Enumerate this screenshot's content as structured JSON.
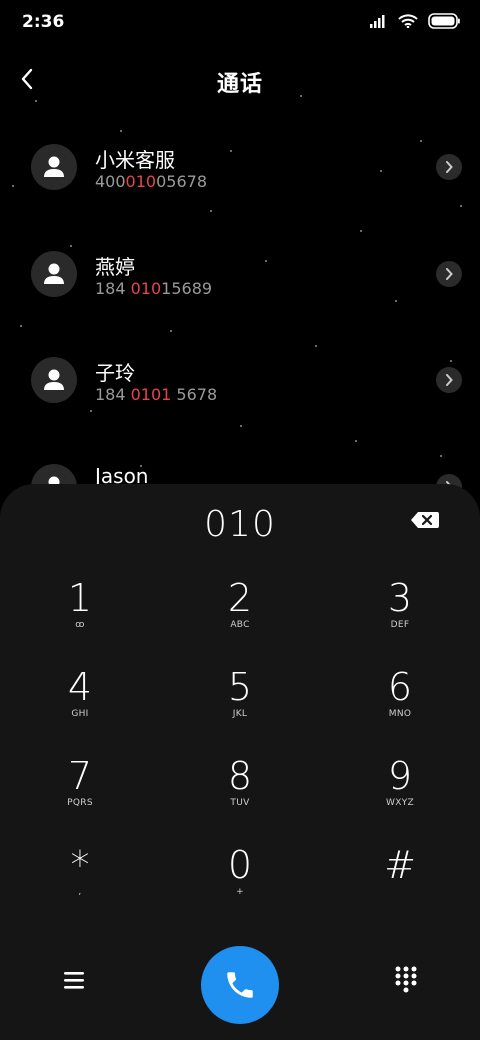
{
  "status": {
    "time": "2:36"
  },
  "header": {
    "title": "通话"
  },
  "contacts": [
    {
      "name": "小米客服",
      "num_pre": "400",
      "num_hl": "010",
      "num_post": "05678"
    },
    {
      "name": "燕婷",
      "num_pre": "184 ",
      "num_hl": "010",
      "num_post": "15689"
    },
    {
      "name": "子玲",
      "num_pre": "184 ",
      "num_hl": "0101",
      "num_post": " 5678"
    },
    {
      "name": "Jason"
    }
  ],
  "dialer": {
    "input": "010",
    "keys": [
      {
        "digit": "1",
        "letters": "ꝏ"
      },
      {
        "digit": "2",
        "letters": "ABC"
      },
      {
        "digit": "3",
        "letters": "DEF"
      },
      {
        "digit": "4",
        "letters": "GHI"
      },
      {
        "digit": "5",
        "letters": "JKL"
      },
      {
        "digit": "6",
        "letters": "MNO"
      },
      {
        "digit": "7",
        "letters": "PQRS"
      },
      {
        "digit": "8",
        "letters": "TUV"
      },
      {
        "digit": "9",
        "letters": "WXYZ"
      },
      {
        "digit": "*",
        "letters": ","
      },
      {
        "digit": "0",
        "letters": "+"
      },
      {
        "digit": "#",
        "letters": ""
      }
    ]
  },
  "colors": {
    "accent": "#1f8ff0",
    "highlight": "#e6454a",
    "panel": "#151515"
  }
}
